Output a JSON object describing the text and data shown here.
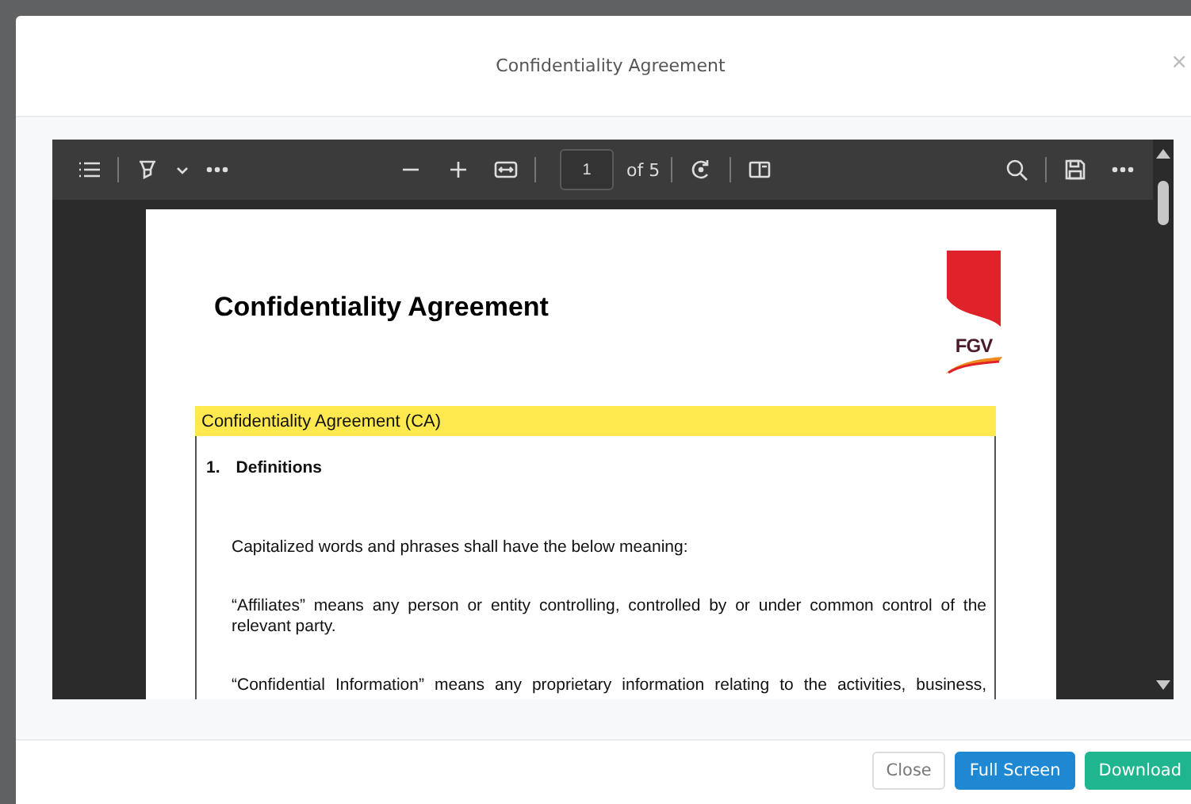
{
  "dialog": {
    "title": "Confidentiality Agreement",
    "close": "×"
  },
  "viewer": {
    "page_field": {
      "value": "1"
    },
    "page_count": "of 5",
    "document": {
      "heading": "Confidentiality Agreement",
      "logo_text": "FGV",
      "section_bar": "Confidentiality Agreement (CA)",
      "section_number": "1.",
      "section_title": "Definitions",
      "paragraphs": [
        "Capitalized words and phrases shall have the below meaning:",
        "“Affiliates” means any person or entity controlling, controlled by or under common control of the relevant party.",
        "“Confidential Information” means any proprietary information relating to the activities, business,"
      ]
    }
  },
  "buttons": [
    {
      "label": "Close",
      "kind": "default"
    },
    {
      "label": "Full Screen",
      "kind": "primary"
    },
    {
      "label": "Download",
      "kind": "success"
    }
  ]
}
